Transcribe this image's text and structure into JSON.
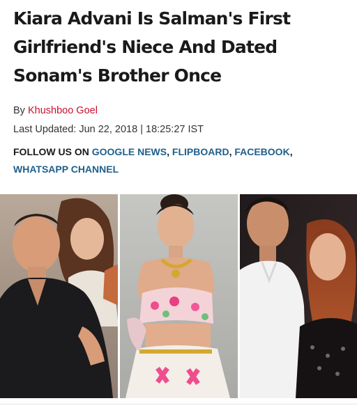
{
  "article": {
    "headline": "Kiara Advani Is Salman's First Girlfriend's Niece And Dated Sonam's Brother Once",
    "byline_prefix": "By ",
    "author": "Khushboo Goel",
    "last_updated_label": "Last Updated: ",
    "last_updated_value": "Jun 22, 2018 | 18:25:27 IST"
  },
  "follow": {
    "prefix": "FOLLOW US ON ",
    "links": [
      "GOOGLE NEWS",
      "FLIPBOARD",
      "FACEBOOK",
      "WHATSAPP CHANNEL"
    ],
    "separators": [
      ", ",
      ", ",
      ","
    ]
  },
  "hero_image": {
    "panels": [
      "man-in-black-shirt-with-woman",
      "woman-in-floral-crop-top-lehenga",
      "man-in-white-shirt-with-woman"
    ]
  },
  "colors": {
    "author_link": "#c8102e",
    "follow_link": "#1f5f8b",
    "headline_text": "#1a1a1a"
  }
}
